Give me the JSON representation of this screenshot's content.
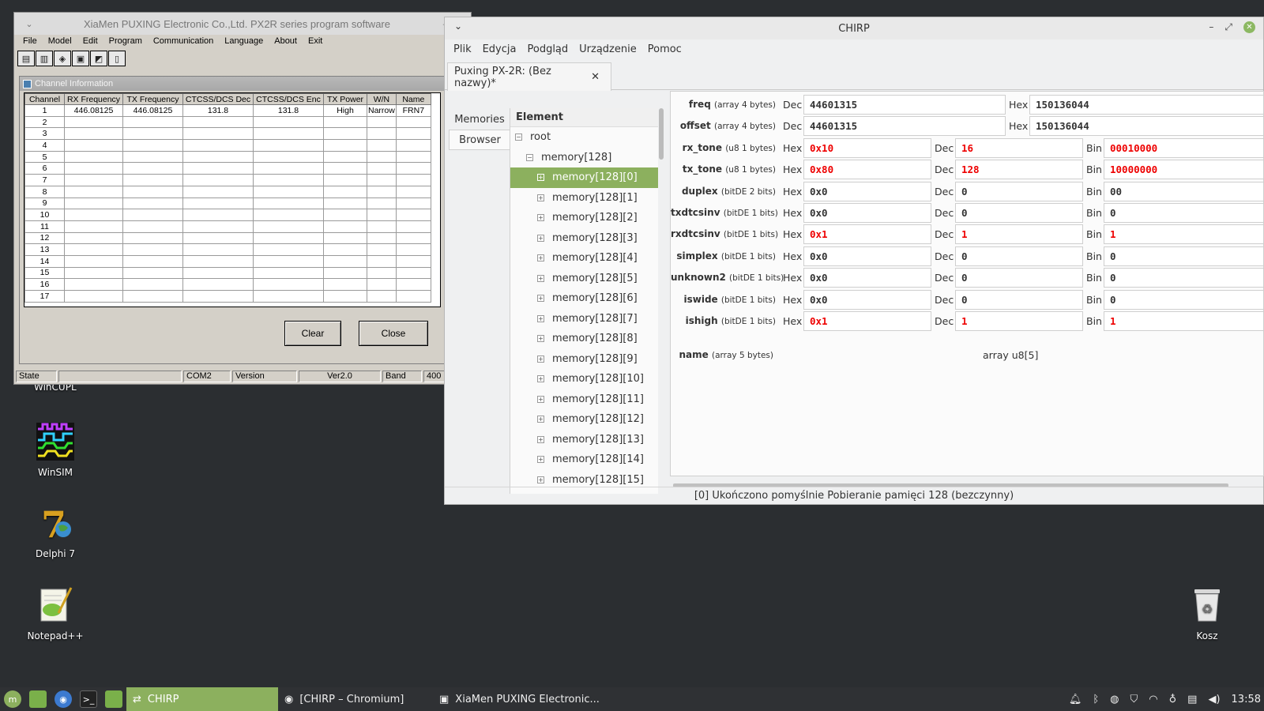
{
  "desktop": {
    "icons": [
      {
        "label": "WinCUPL"
      },
      {
        "label": "WinSIM"
      },
      {
        "label": "Delphi 7"
      },
      {
        "label": "Notepad++"
      },
      {
        "label": "Kosz"
      }
    ]
  },
  "puxing": {
    "title": "XiaMen PUXING Electronic Co.,Ltd. PX2R series program software",
    "menu": [
      "File",
      "Model",
      "Edit",
      "Program",
      "Communication",
      "Language",
      "About",
      "Exit"
    ],
    "toolbar_icons": [
      "read-icon",
      "save-icon",
      "open-icon",
      "download-icon",
      "upload-icon",
      "info-icon"
    ],
    "subwindow_title": "Channel Information",
    "columns": [
      "Channel",
      "RX Frequency",
      "TX Frequency",
      "CTCSS/DCS Dec",
      "CTCSS/DCS Enc",
      "TX Power",
      "W/N",
      "Name"
    ],
    "rows": [
      [
        "1",
        "446.08125",
        "446.08125",
        "131.8",
        "131.8",
        "High",
        "Narrow",
        "FRN7"
      ],
      [
        "2",
        "",
        "",
        "",
        "",
        "",
        "",
        ""
      ],
      [
        "3",
        "",
        "",
        "",
        "",
        "",
        "",
        ""
      ],
      [
        "4",
        "",
        "",
        "",
        "",
        "",
        "",
        ""
      ],
      [
        "5",
        "",
        "",
        "",
        "",
        "",
        "",
        ""
      ],
      [
        "6",
        "",
        "",
        "",
        "",
        "",
        "",
        ""
      ],
      [
        "7",
        "",
        "",
        "",
        "",
        "",
        "",
        ""
      ],
      [
        "8",
        "",
        "",
        "",
        "",
        "",
        "",
        ""
      ],
      [
        "9",
        "",
        "",
        "",
        "",
        "",
        "",
        ""
      ],
      [
        "10",
        "",
        "",
        "",
        "",
        "",
        "",
        ""
      ],
      [
        "11",
        "",
        "",
        "",
        "",
        "",
        "",
        ""
      ],
      [
        "12",
        "",
        "",
        "",
        "",
        "",
        "",
        ""
      ],
      [
        "13",
        "",
        "",
        "",
        "",
        "",
        "",
        ""
      ],
      [
        "14",
        "",
        "",
        "",
        "",
        "",
        "",
        ""
      ],
      [
        "15",
        "",
        "",
        "",
        "",
        "",
        "",
        ""
      ],
      [
        "16",
        "",
        "",
        "",
        "",
        "",
        "",
        ""
      ],
      [
        "17",
        "",
        "",
        "",
        "",
        "",
        "",
        ""
      ]
    ],
    "buttons": {
      "clear": "Clear",
      "close": "Close"
    },
    "status": {
      "state": "State",
      "port": "COM2",
      "version_label": "Version",
      "version": "Ver2.0",
      "band_label": "Band",
      "band": "400"
    }
  },
  "chirp": {
    "title": "CHIRP",
    "menu": [
      "Plik",
      "Edycja",
      "Podgląd",
      "Urządzenie",
      "Pomoc"
    ],
    "tab": "Puxing PX-2R: (Bez nazwy)*",
    "side_tabs": [
      "Memories",
      "Browser"
    ],
    "tree_header": "Element",
    "tree": {
      "root": "root",
      "memory": "memory[128]",
      "items": [
        "memory[128][0]",
        "memory[128][1]",
        "memory[128][2]",
        "memory[128][3]",
        "memory[128][4]",
        "memory[128][5]",
        "memory[128][6]",
        "memory[128][7]",
        "memory[128][8]",
        "memory[128][9]",
        "memory[128][10]",
        "memory[128][11]",
        "memory[128][12]",
        "memory[128][13]",
        "memory[128][14]",
        "memory[128][15]"
      ]
    },
    "fields": [
      {
        "name": "freq",
        "type": "(array 4 bytes)",
        "l1": "Dec",
        "v1": "44601315",
        "l2": "Hex",
        "v2": "150136044"
      },
      {
        "name": "offset",
        "type": "(array 4 bytes)",
        "l1": "Dec",
        "v1": "44601315",
        "l2": "Hex",
        "v2": "150136044"
      },
      {
        "name": "rx_tone",
        "type": "(u8 1 bytes)",
        "hex": "0x10",
        "dec": "16",
        "bin": "00010000",
        "red": true
      },
      {
        "name": "tx_tone",
        "type": "(u8 1 bytes)",
        "hex": "0x80",
        "dec": "128",
        "bin": "10000000",
        "red": true
      },
      {
        "name": "duplex",
        "type": "(bitDE 2 bits)",
        "hex": "0x0",
        "dec": "0",
        "bin": "00",
        "red": false
      },
      {
        "name": "txdtcsinv",
        "type": "(bitDE 1 bits)",
        "hex": "0x0",
        "dec": "0",
        "bin": "0",
        "red": false
      },
      {
        "name": "rxdtcsinv",
        "type": "(bitDE 1 bits)",
        "hex": "0x1",
        "dec": "1",
        "bin": "1",
        "red": true
      },
      {
        "name": "simplex",
        "type": "(bitDE 1 bits)",
        "hex": "0x0",
        "dec": "0",
        "bin": "0",
        "red": false
      },
      {
        "name": "unknown2",
        "type": "(bitDE 1 bits)",
        "hex": "0x0",
        "dec": "0",
        "bin": "0",
        "red": false
      },
      {
        "name": "iswide",
        "type": "(bitDE 1 bits)",
        "hex": "0x0",
        "dec": "0",
        "bin": "0",
        "red": false
      },
      {
        "name": "ishigh",
        "type": "(bitDE 1 bits)",
        "hex": "0x1",
        "dec": "1",
        "bin": "1",
        "red": true
      }
    ],
    "labels": {
      "hex": "Hex",
      "dec": "Dec",
      "bin": "Bin"
    },
    "name_field": {
      "name": "name",
      "type": "(array 5 bytes)",
      "value": "array u8[5]"
    },
    "status": "[0] Ukończono pomyślnie Pobieranie pamięci 128 (bezczynny)"
  },
  "taskbar": {
    "tasks": [
      {
        "label": "CHIRP",
        "active": true
      },
      {
        "label": "[CHIRP – Chromium]",
        "active": false
      },
      {
        "label": "XiaMen PUXING Electronic...",
        "active": false
      }
    ],
    "clock": "13:58"
  },
  "colors": {
    "accent": "#8cb05e",
    "highlight_value": "#e00000",
    "taskbar": "#2f3134",
    "desktop": "#2b2e31"
  }
}
